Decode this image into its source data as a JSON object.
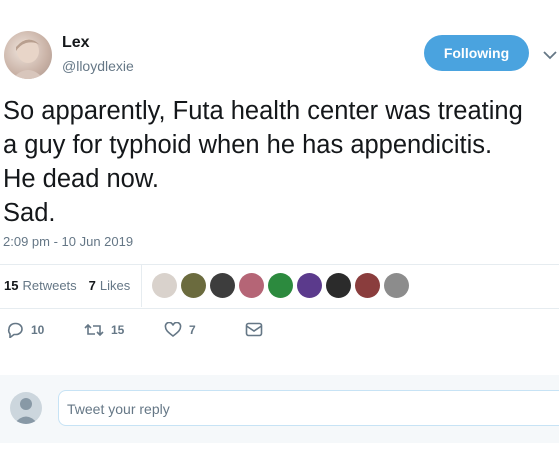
{
  "user": {
    "name": "Lex",
    "handle": "@lloydlexie"
  },
  "follow_button_label": "Following",
  "tweet": {
    "text": "So apparently, Futa health center was treating\na guy for typhoid when he has appendicitis.\nHe dead now.\nSad.",
    "timestamp": "2:09 pm - 10 Jun 2019"
  },
  "stats": {
    "retweets_count": "15",
    "retweets_label": "Retweets",
    "likes_count": "7",
    "likes_label": "Likes"
  },
  "liker_avatar_colors": [
    "#d9d2cc",
    "#6b6b3e",
    "#3d3d3d",
    "#b56576",
    "#2c8a3e",
    "#5b3a8c",
    "#2b2b2b",
    "#8a3d3d",
    "#8c8c8c"
  ],
  "actions": {
    "reply_count": "10",
    "retweet_count": "15",
    "like_count": "7"
  },
  "reply": {
    "placeholder": "Tweet your reply"
  },
  "colors": {
    "accent": "#4aa3df",
    "muted": "#657786"
  }
}
